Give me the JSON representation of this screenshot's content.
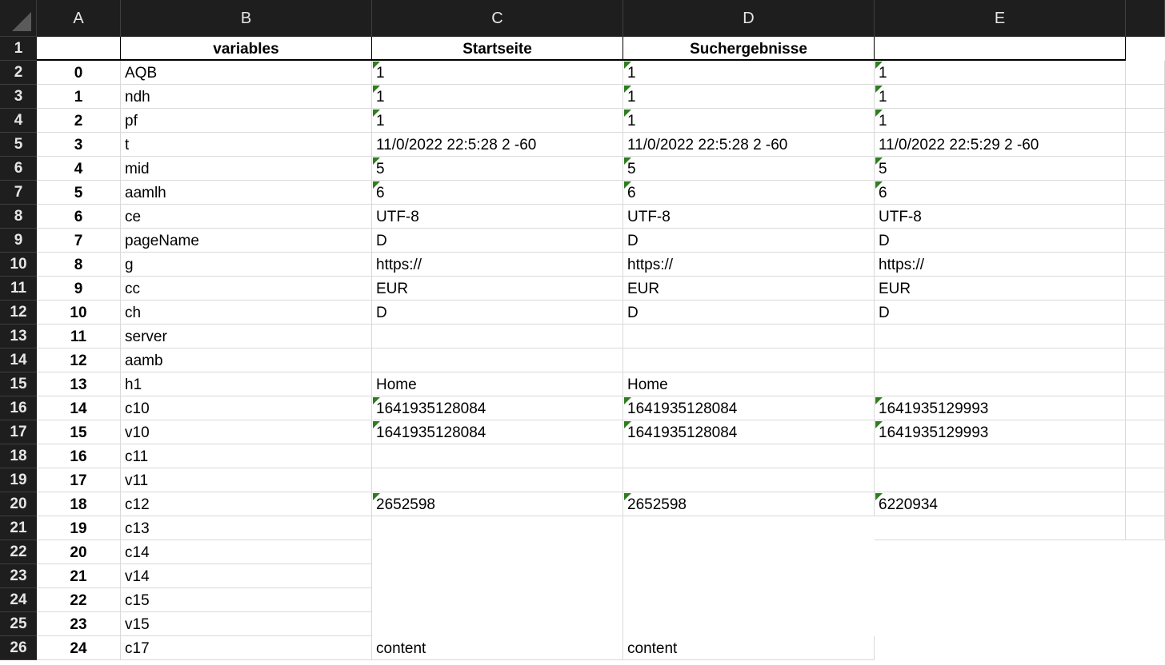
{
  "corner": "",
  "columns": [
    "A",
    "B",
    "C",
    "D",
    "E"
  ],
  "header_row": {
    "row_number": "1",
    "a": "",
    "b": "variables",
    "c": "Startseite",
    "d": "Suchergebnisse",
    "e": ""
  },
  "rows": [
    {
      "row": "2",
      "a": "0",
      "b": "AQB",
      "c": "1",
      "d": "1",
      "e": "1"
    },
    {
      "row": "3",
      "a": "1",
      "b": "ndh",
      "c": "1",
      "d": "1",
      "e": "1"
    },
    {
      "row": "4",
      "a": "2",
      "b": "pf",
      "c": "1",
      "d": "1",
      "e": "1"
    },
    {
      "row": "5",
      "a": "3",
      "b": "t",
      "c": "11/0/2022 22:5:28 2 -60",
      "d": "11/0/2022 22:5:28 2 -60",
      "e": "11/0/2022 22:5:29 2 -60"
    },
    {
      "row": "6",
      "a": "4",
      "b": "mid",
      "c": "5",
      "d": "5",
      "e": "5"
    },
    {
      "row": "7",
      "a": "5",
      "b": "aamlh",
      "c": "6",
      "d": "6",
      "e": "6"
    },
    {
      "row": "8",
      "a": "6",
      "b": "ce",
      "c": "UTF-8",
      "d": "UTF-8",
      "e": "UTF-8"
    },
    {
      "row": "9",
      "a": "7",
      "b": "pageName",
      "c": "D",
      "d": "D",
      "e": "D"
    },
    {
      "row": "10",
      "a": "8",
      "b": "g",
      "c": "https://",
      "d": "https://",
      "e": "https://"
    },
    {
      "row": "11",
      "a": "9",
      "b": "cc",
      "c": "EUR",
      "d": "EUR",
      "e": "EUR"
    },
    {
      "row": "12",
      "a": "10",
      "b": "ch",
      "c": "D",
      "d": "D",
      "e": "D"
    },
    {
      "row": "13",
      "a": "11",
      "b": "server",
      "c": "",
      "d": "",
      "e": ""
    },
    {
      "row": "14",
      "a": "12",
      "b": "aamb",
      "c": "",
      "d": "",
      "e": ""
    },
    {
      "row": "15",
      "a": "13",
      "b": "h1",
      "c": "Home",
      "d": "Home",
      "e": ""
    },
    {
      "row": "16",
      "a": "14",
      "b": "c10",
      "c": "1641935128084",
      "d": "1641935128084",
      "e": "1641935129993"
    },
    {
      "row": "17",
      "a": "15",
      "b": "v10",
      "c": "1641935128084",
      "d": "1641935128084",
      "e": "1641935129993"
    },
    {
      "row": "18",
      "a": "16",
      "b": "c11",
      "c": "",
      "d": "",
      "e": ""
    },
    {
      "row": "19",
      "a": "17",
      "b": "v11",
      "c": "",
      "d": "",
      "e": ""
    },
    {
      "row": "20",
      "a": "18",
      "b": "c12",
      "c": "2652598",
      "d": "2652598",
      "e": "6220934"
    },
    {
      "row": "21",
      "a": "19",
      "b": "c13",
      "c": "",
      "d": "",
      "e": ""
    },
    {
      "row": "22",
      "a": "20",
      "b": "c14",
      "c": "",
      "d": "",
      "e": ""
    },
    {
      "row": "23",
      "a": "21",
      "b": "v14",
      "c": "",
      "d": "",
      "e": ""
    },
    {
      "row": "24",
      "a": "22",
      "b": "c15",
      "c": "",
      "d": "",
      "e": ""
    },
    {
      "row": "25",
      "a": "23",
      "b": "v15",
      "c": "",
      "d": "",
      "e": ""
    },
    {
      "row": "26",
      "a": "24",
      "b": "c17",
      "c": "content",
      "d": "content",
      "e": ""
    }
  ],
  "flagged_cells": {
    "rows_with_flags": [
      "2",
      "3",
      "4",
      "6",
      "7",
      "16",
      "17",
      "20"
    ]
  },
  "colors": {
    "header_bg": "#1e1e1e",
    "header_text": "#e6e6e6",
    "flag": "#2e7d1f",
    "grid": "#d9d9d9"
  }
}
